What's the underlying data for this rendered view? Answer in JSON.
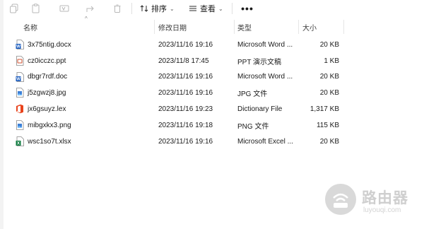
{
  "toolbar": {
    "icons": [
      "copy-icon",
      "paste-icon",
      "rename-icon",
      "share-icon",
      "delete-icon"
    ],
    "sort_label": "排序",
    "view_label": "查看",
    "more_label": "•••"
  },
  "header": {
    "name": "名称",
    "date": "修改日期",
    "type": "类型",
    "size": "大小"
  },
  "files": [
    {
      "name": "3x75ntig.docx",
      "date": "2023/11/16 19:16",
      "type": "Microsoft Word ...",
      "size": "20 KB",
      "icon": "word-doc-icon"
    },
    {
      "name": "cz0icczc.ppt",
      "date": "2023/11/8 17:45",
      "type": "PPT 演示文稿",
      "size": "1 KB",
      "icon": "ppt-file-icon"
    },
    {
      "name": "dbgr7rdf.doc",
      "date": "2023/11/16 19:16",
      "type": "Microsoft Word ...",
      "size": "20 KB",
      "icon": "word-doc-icon"
    },
    {
      "name": "j5zgwzj8.jpg",
      "date": "2023/11/16 19:16",
      "type": "JPG 文件",
      "size": "20 KB",
      "icon": "image-file-icon"
    },
    {
      "name": "jx6gsuyz.lex",
      "date": "2023/11/16 19:23",
      "type": "Dictionary File",
      "size": "1,317 KB",
      "icon": "office-lex-icon"
    },
    {
      "name": "mibgxkx3.png",
      "date": "2023/11/16 19:18",
      "type": "PNG 文件",
      "size": "115 KB",
      "icon": "image-file-icon"
    },
    {
      "name": "wsc1so7t.xlsx",
      "date": "2023/11/16 19:16",
      "type": "Microsoft Excel ...",
      "size": "20 KB",
      "icon": "excel-file-icon"
    }
  ],
  "watermark": {
    "title": "路由器",
    "subtitle": "luyouqi.com"
  }
}
